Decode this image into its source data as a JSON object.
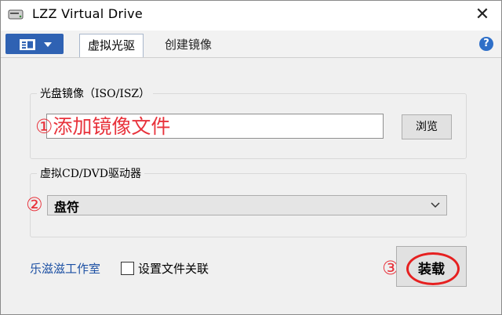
{
  "window": {
    "title": "LZZ Virtual Drive"
  },
  "tabs": [
    {
      "label": "虚拟光驱",
      "active": true
    },
    {
      "label": "创建镜像",
      "active": false
    }
  ],
  "icons": {
    "app": "drive-icon",
    "menu": "menu-icon",
    "help": "help-icon",
    "close": "close-icon",
    "chevron": "chevron-down-icon"
  },
  "help_glyph": "?",
  "close_glyph": "✕",
  "iso_group": {
    "label": "光盘镜像（ISO/ISZ）",
    "input_value": "",
    "annotation": "①添加镜像文件",
    "browse_label": "浏览"
  },
  "drive_group": {
    "label": "虚拟CD/DVD驱动器",
    "annotation_number": "②",
    "selected": "盘符"
  },
  "footer": {
    "studio_link": "乐滋滋工作室",
    "assoc_checkbox_label": "设置文件关联",
    "assoc_checked": false,
    "mount_annotation_number": "③",
    "mount_label": "装载"
  },
  "colors": {
    "accent": "#2f62b3",
    "annotation": "#e8333c",
    "link": "#1b4fa3"
  }
}
